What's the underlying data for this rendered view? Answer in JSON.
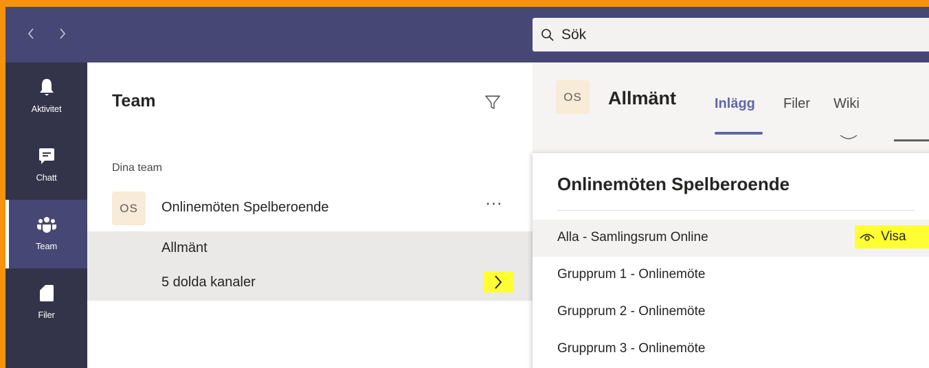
{
  "titlebar": {
    "back_icon": "chevron-left-icon",
    "forward_icon": "chevron-right-icon",
    "search_placeholder": "Sök",
    "search_icon": "search-icon"
  },
  "rail": {
    "items": [
      {
        "label": "Aktivitet",
        "icon": "bell-icon",
        "active": false
      },
      {
        "label": "Chatt",
        "icon": "chat-icon",
        "active": false
      },
      {
        "label": "Team",
        "icon": "teams-icon",
        "active": true
      },
      {
        "label": "Filer",
        "icon": "file-icon",
        "active": false
      }
    ]
  },
  "teams_pane": {
    "title": "Team",
    "section_label": "Dina team",
    "team": {
      "avatar_initials": "OS",
      "name": "Onlinemöten Spelberoende",
      "more": "···"
    },
    "channels": [
      {
        "label": "Allmänt"
      },
      {
        "label": "5 dolda kanaler"
      }
    ]
  },
  "channel_header": {
    "avatar_initials": "OS",
    "title": "Allmänt",
    "tabs": [
      {
        "label": "Inlägg",
        "active": true
      },
      {
        "label": "Filer",
        "active": false
      },
      {
        "label": "Wiki",
        "active": false
      }
    ]
  },
  "hidden_channels_flyout": {
    "title": "Onlinemöten Spelberoende",
    "show_label": "Visa",
    "show_icon": "eye-icon",
    "items": [
      {
        "label": "Alla - Samlingsrum Online"
      },
      {
        "label": "Grupprum 1 - Onlinemöte"
      },
      {
        "label": "Grupprum 2 - Onlinemöte"
      },
      {
        "label": "Grupprum 3 - Onlinemöte"
      }
    ]
  },
  "colors": {
    "outer_frame": "#f5930c",
    "titlebar": "#464775",
    "rail": "#33344a",
    "accent": "#6264a7",
    "highlight": "#ffff33",
    "avatar_bg": "#f8ebd7"
  }
}
